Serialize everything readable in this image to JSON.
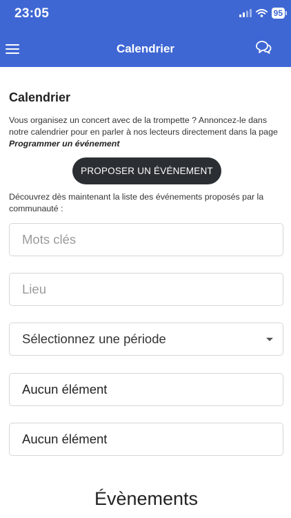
{
  "status_bar": {
    "time": "23:05",
    "battery": "95"
  },
  "nav": {
    "title": "Calendrier"
  },
  "page": {
    "title": "Calendrier",
    "intro": "Vous organisez un concert avec de la trompette ? Annoncez-le dans notre calendrier pour en parler à nos lecteurs directement dans la page",
    "intro_link": "Programmer un événement",
    "propose_button": "PROPOSER UN ÉVÉNEMENT",
    "discover": "Découvrez dès maintenant la liste des événements proposés par la communauté :"
  },
  "filters": {
    "keywords_placeholder": "Mots clés",
    "location_placeholder": "Lieu",
    "period_select": "Sélectionnez une période",
    "field1_value": "Aucun élément",
    "field2_value": "Aucun élément"
  },
  "events": {
    "heading": "Évènements"
  },
  "colors": {
    "header_bg": "#3f67d4",
    "button_bg": "#2b2f33"
  }
}
